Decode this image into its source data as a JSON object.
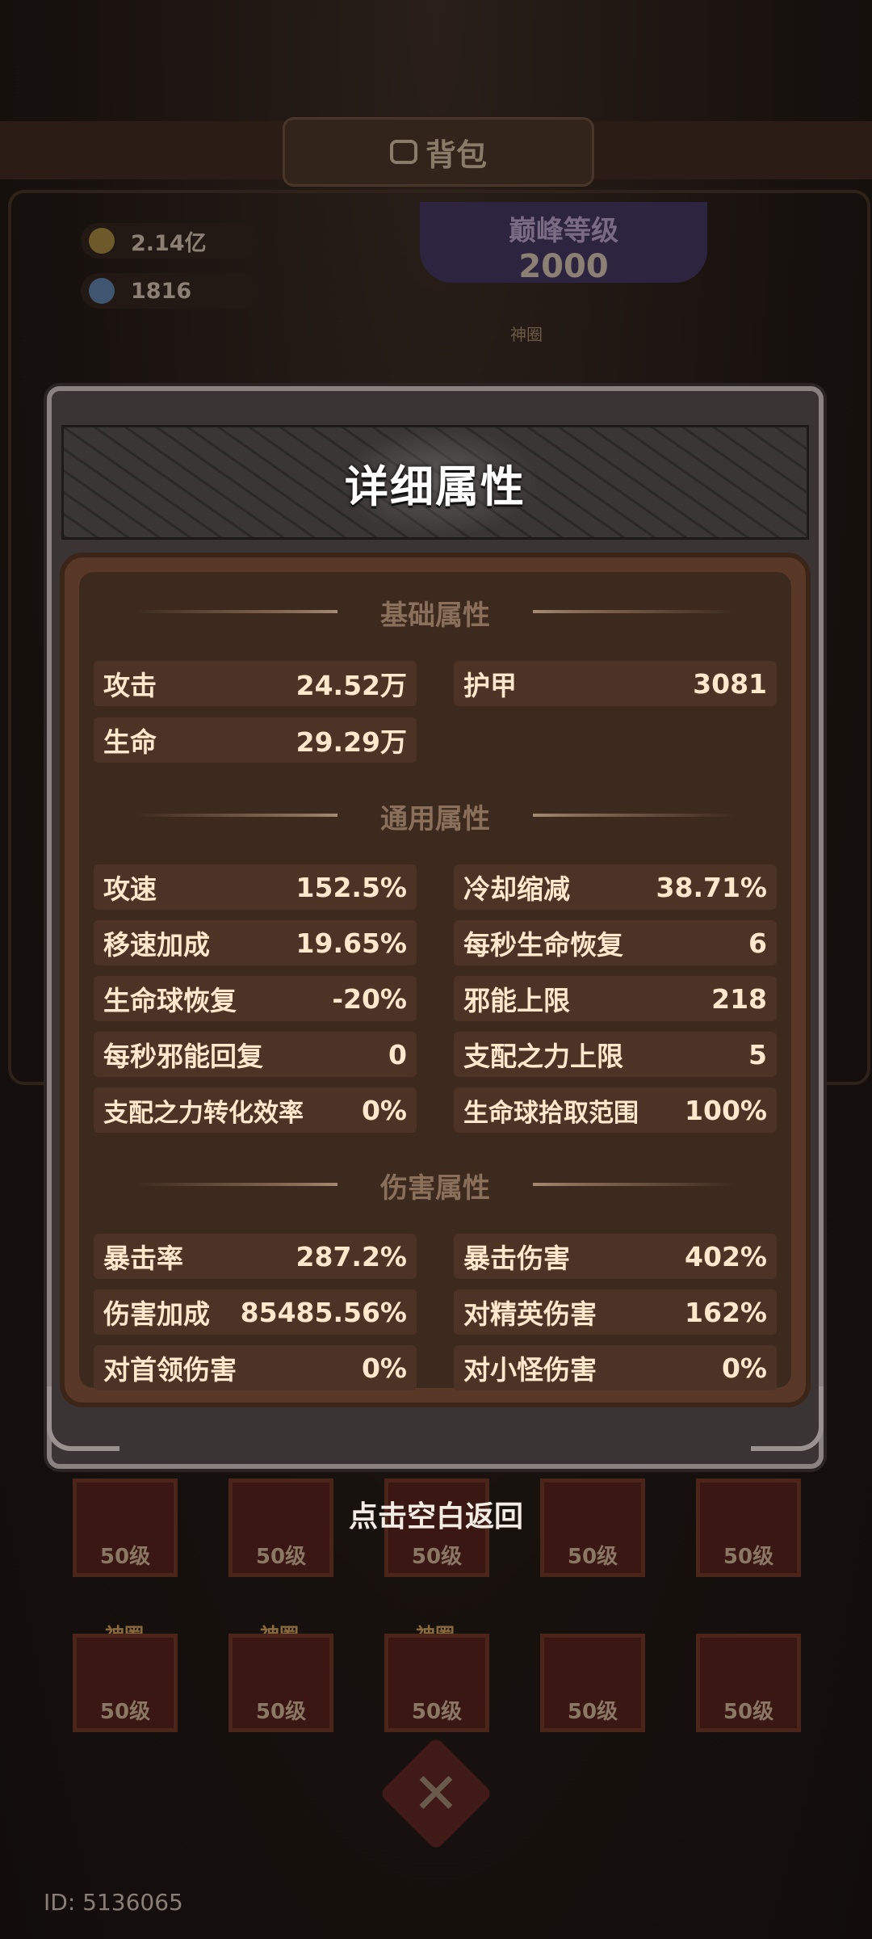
{
  "background": {
    "title": "背包",
    "currency_gold": "2.14亿",
    "currency_gem": "1816",
    "peak_label": "巅峰等级",
    "peak_level": "2000",
    "lock_tag": "神圈",
    "slot_level": "50级",
    "slot_tag": "神圈"
  },
  "modal": {
    "title": "详细属性",
    "sections": {
      "basic": "基础属性",
      "common": "通用属性",
      "damage": "伤害属性"
    },
    "basic": [
      {
        "name": "攻击",
        "value": "24.52万"
      },
      {
        "name": "护甲",
        "value": "3081"
      },
      {
        "name": "生命",
        "value": "29.29万"
      }
    ],
    "common": [
      {
        "name": "攻速",
        "value": "152.5%"
      },
      {
        "name": "冷却缩减",
        "value": "38.71%"
      },
      {
        "name": "移速加成",
        "value": "19.65%"
      },
      {
        "name": "每秒生命恢复",
        "value": "6"
      },
      {
        "name": "生命球恢复",
        "value": "-20%"
      },
      {
        "name": "邪能上限",
        "value": "218"
      },
      {
        "name": "每秒邪能回复",
        "value": "0"
      },
      {
        "name": "支配之力上限",
        "value": "5"
      },
      {
        "name": "支配之力转化效率",
        "value": "0%"
      },
      {
        "name": "生命球拾取范围",
        "value": "100%"
      }
    ],
    "damage": [
      {
        "name": "暴击率",
        "value": "287.2%"
      },
      {
        "name": "暴击伤害",
        "value": "402%"
      },
      {
        "name": "伤害加成",
        "value": "85485.56%"
      },
      {
        "name": "对精英伤害",
        "value": "162%"
      },
      {
        "name": "对首领伤害",
        "value": "0%"
      },
      {
        "name": "对小怪伤害",
        "value": "0%"
      }
    ],
    "dismiss_hint": "点击空白返回"
  },
  "footer": {
    "player_id": "ID: 5136065"
  }
}
